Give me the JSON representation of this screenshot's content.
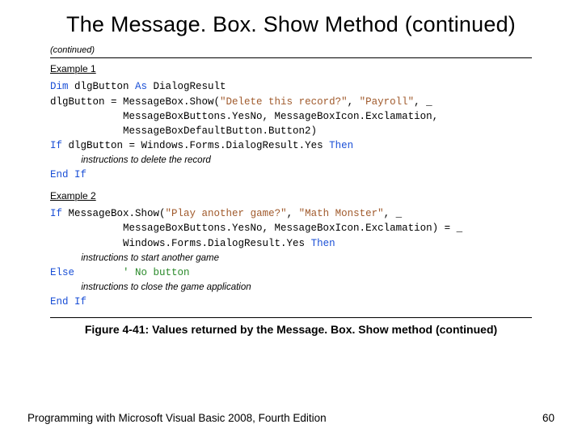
{
  "title": "The Message. Box. Show Method (continued)",
  "continued_note": "(continued)",
  "example1": {
    "label": "Example 1",
    "code": {
      "l1": {
        "kw1": "Dim",
        "var": " dlgButton ",
        "kw2": "As",
        "type": " DialogResult"
      },
      "l2": {
        "lhs": "dlgButton = MessageBox.Show(",
        "s1": "\"Delete this record?\"",
        "sep1": ", ",
        "s2": "\"Payroll\"",
        "trail": ", _"
      },
      "l3": "            MessageBoxButtons.YesNo, MessageBoxIcon.Exclamation,",
      "l4": "            MessageBoxDefaultButton.Button2)",
      "l5": {
        "kw1": "If",
        "mid": " dlgButton = Windows.Forms.DialogResult.Yes ",
        "kw2": "Then"
      },
      "l6": "            instructions to delete the record",
      "l7": {
        "kw1": "End",
        "sp": " ",
        "kw2": "If"
      }
    }
  },
  "example2": {
    "label": "Example 2",
    "code": {
      "l1": {
        "kw1": "If",
        "pre": " MessageBox.Show(",
        "s1": "\"Play another game?\"",
        "sep1": ", ",
        "s2": "\"Math Monster\"",
        "trail": ", _"
      },
      "l2": "            MessageBoxButtons.YesNo, MessageBoxIcon.Exclamation) = _",
      "l3": {
        "pre": "            Windows.Forms.DialogResult.Yes ",
        "kw1": "Then"
      },
      "l4": "            instructions to start another game",
      "l5": {
        "kw1": "Else",
        "sp": "        ",
        "cmt": "' No button"
      },
      "l6": "            instructions to close the game application",
      "l7": {
        "kw1": "End",
        "sp": " ",
        "kw2": "If"
      }
    }
  },
  "figure_caption": "Figure 4-41: Values returned by the Message. Box. Show method (continued)",
  "footer_text": "Programming with Microsoft Visual Basic 2008, Fourth Edition",
  "page_number": "60"
}
